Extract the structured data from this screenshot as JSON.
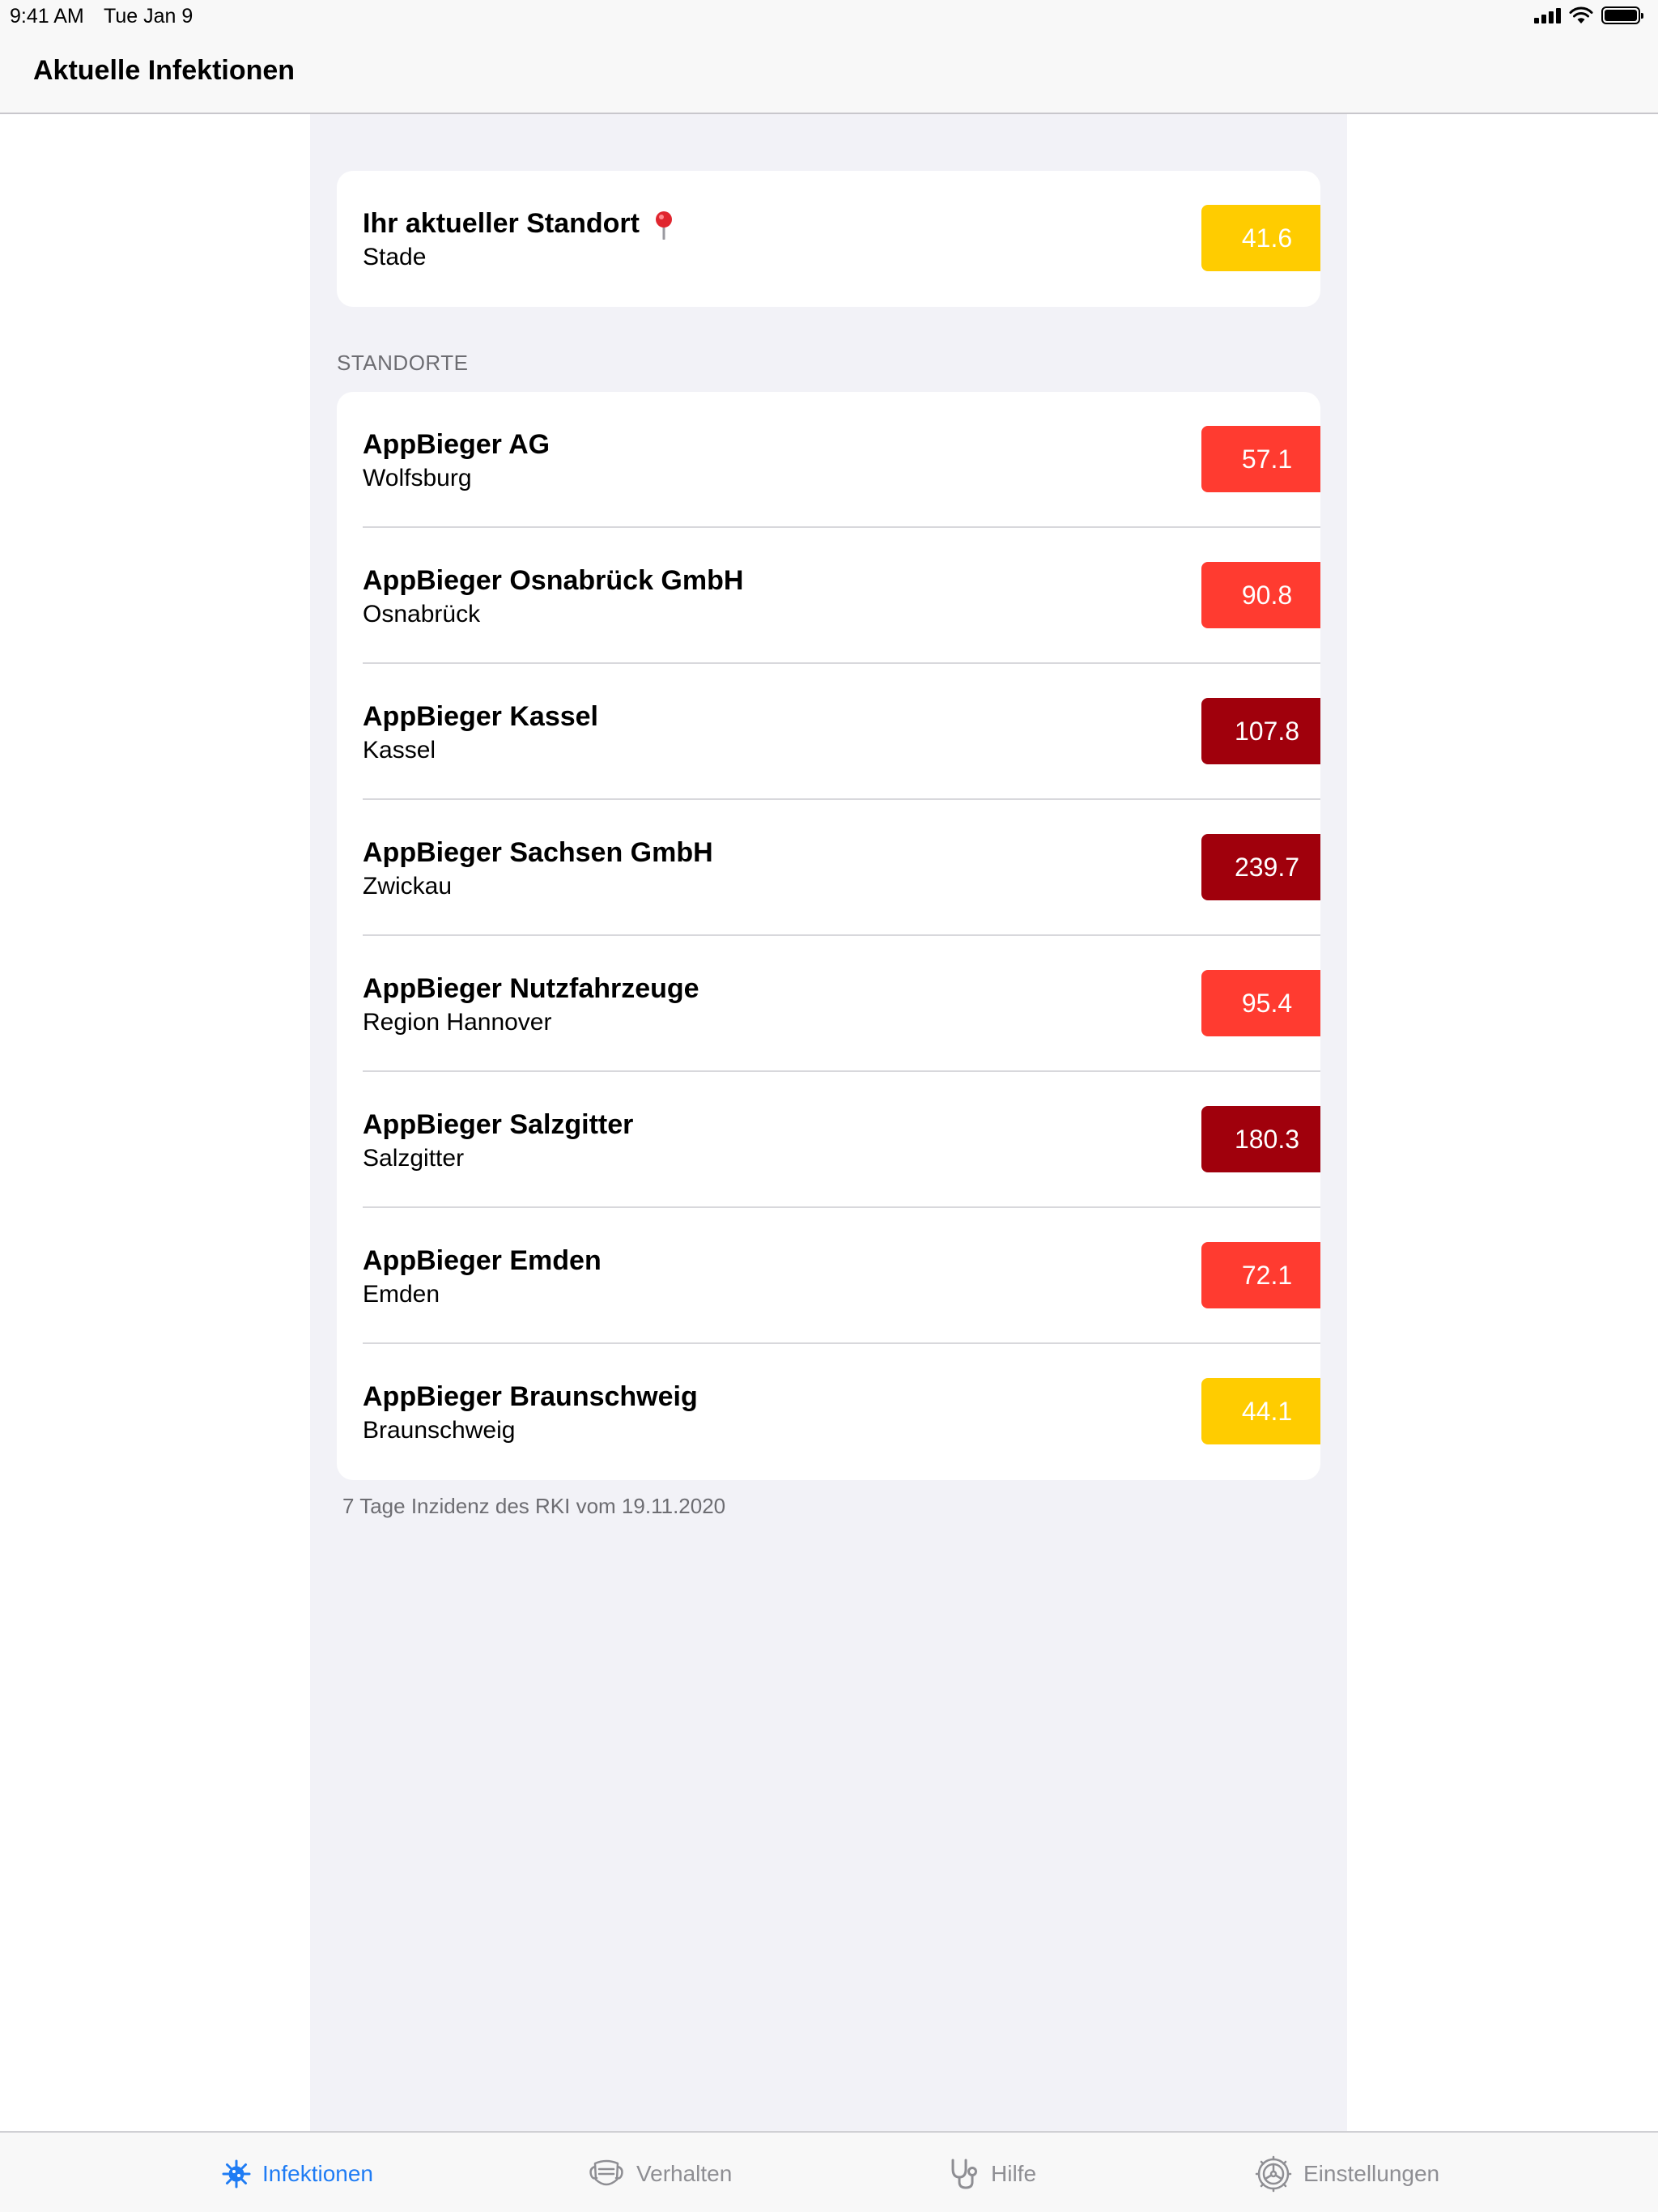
{
  "status_bar": {
    "time": "9:41 AM",
    "date": "Tue Jan 9"
  },
  "navbar": {
    "title": "Aktuelle Infektionen"
  },
  "current_location": {
    "title": "Ihr aktueller Standort",
    "icon": "pin-icon",
    "city": "Stade",
    "value": "41.6",
    "color": "#FFCC00"
  },
  "section_header": "STANDORTE",
  "locations": [
    {
      "name": "AppBieger AG",
      "city": "Wolfsburg",
      "value": "57.1",
      "color": "#FF3B30"
    },
    {
      "name": "AppBieger Osnabrück GmbH",
      "city": "Osnabrück",
      "value": "90.8",
      "color": "#FF3B30"
    },
    {
      "name": "AppBieger Kassel",
      "city": "Kassel",
      "value": "107.8",
      "color": "#A0000C"
    },
    {
      "name": "AppBieger Sachsen GmbH",
      "city": "Zwickau",
      "value": "239.7",
      "color": "#A0000C"
    },
    {
      "name": "AppBieger Nutzfahrzeuge",
      "city": "Region Hannover",
      "value": "95.4",
      "color": "#FF3B30"
    },
    {
      "name": "AppBieger Salzgitter",
      "city": "Salzgitter",
      "value": "180.3",
      "color": "#A0000C"
    },
    {
      "name": "AppBieger Emden",
      "city": "Emden",
      "value": "72.1",
      "color": "#FF3B30"
    },
    {
      "name": "AppBieger Braunschweig",
      "city": "Braunschweig",
      "value": "44.1",
      "color": "#FFCC00"
    }
  ],
  "footnote": "7 Tage Inzidenz des RKI vom 19.11.2020",
  "tabs": [
    {
      "label": "Infektionen",
      "icon": "virus-icon",
      "active": true
    },
    {
      "label": "Verhalten",
      "icon": "mask-icon",
      "active": false
    },
    {
      "label": "Hilfe",
      "icon": "stethoscope-icon",
      "active": false
    },
    {
      "label": "Einstellungen",
      "icon": "gear-icon",
      "active": false
    }
  ],
  "colors": {
    "accent": "#1F7CF4",
    "yellow": "#FFCC00",
    "red": "#FF3B30",
    "dark_red": "#A0000C"
  }
}
